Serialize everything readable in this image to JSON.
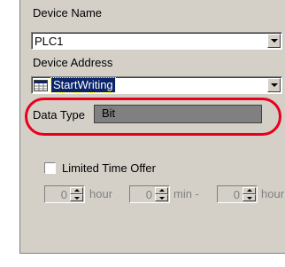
{
  "device": {
    "name_label": "Device Name",
    "name_value": "PLC1",
    "address_label": "Device Address",
    "address_value": "StartWriting",
    "address_icon": "address-table-icon"
  },
  "data_type": {
    "label": "Data Type",
    "value": "Bit",
    "highlight_color": "#e8001c"
  },
  "limited_offer": {
    "checkbox_label": "Limited Time Offer",
    "checked": false,
    "hour_value": "0",
    "hour_unit": "hour",
    "min_value": "0",
    "min_unit": "min -",
    "hour2_value": "0",
    "hour2_unit": "hour"
  }
}
